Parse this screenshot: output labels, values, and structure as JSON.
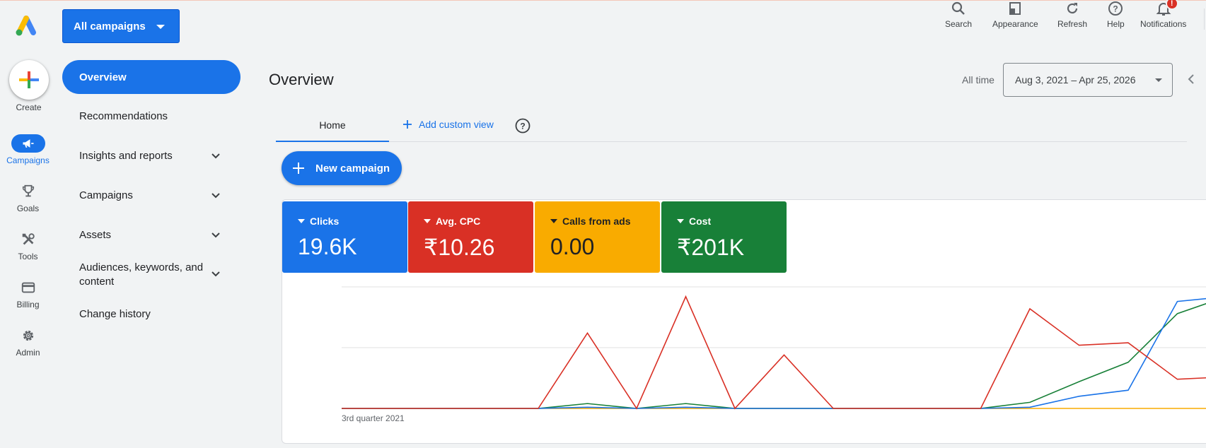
{
  "header": {
    "campaign_selector": "All campaigns",
    "actions": [
      {
        "label": "Search",
        "icon": "search-icon"
      },
      {
        "label": "Appearance",
        "icon": "appearance-icon"
      },
      {
        "label": "Refresh",
        "icon": "refresh-icon"
      },
      {
        "label": "Help",
        "icon": "help-icon"
      },
      {
        "label": "Notifications",
        "icon": "notifications-icon",
        "badge": "!"
      }
    ]
  },
  "rail": {
    "create_label": "Create",
    "items": [
      {
        "label": "Campaigns",
        "icon": "campaigns-icon",
        "active": true
      },
      {
        "label": "Goals",
        "icon": "trophy-icon"
      },
      {
        "label": "Tools",
        "icon": "tools-icon"
      },
      {
        "label": "Billing",
        "icon": "billing-icon"
      },
      {
        "label": "Admin",
        "icon": "gear-icon"
      }
    ]
  },
  "nav": {
    "items": [
      {
        "label": "Overview",
        "active": true
      },
      {
        "label": "Recommendations"
      },
      {
        "label": "Insights and reports",
        "expandable": true
      },
      {
        "label": "Campaigns",
        "expandable": true
      },
      {
        "label": "Assets",
        "expandable": true
      },
      {
        "label": "Audiences, keywords, and content",
        "expandable": true
      },
      {
        "label": "Change history"
      }
    ]
  },
  "main": {
    "title": "Overview",
    "date_preset": "All time",
    "date_range": "Aug 3, 2021 – Apr 25, 2026",
    "tabs": {
      "home": "Home",
      "add_custom": "Add custom view"
    },
    "new_campaign": "New campaign",
    "metrics": [
      {
        "name": "Clicks",
        "value": "19.6K",
        "color": "#1a73e8"
      },
      {
        "name": "Avg. CPC",
        "value": "₹10.26",
        "color": "#d93025"
      },
      {
        "name": "Calls from ads",
        "value": "0.00",
        "color": "#f9ab00"
      },
      {
        "name": "Cost",
        "value": "₹201K",
        "color": "#188038"
      }
    ]
  },
  "chart_data": {
    "type": "line",
    "x_start_label": "3rd quarter 2021",
    "grid": true,
    "series": [
      {
        "name": "Avg. CPC",
        "color": "#d93025",
        "values": [
          0,
          0,
          0,
          0,
          0,
          0.62,
          0,
          0.92,
          0,
          0.44,
          0,
          0,
          0,
          0,
          0.82,
          0.52,
          0.54,
          0.24,
          0.26,
          0.32
        ]
      },
      {
        "name": "Clicks",
        "color": "#1a73e8",
        "values": [
          0,
          0,
          0,
          0,
          0,
          0.01,
          0,
          0.01,
          0,
          0,
          0,
          0,
          0,
          0,
          0.01,
          0.1,
          0.15,
          0.88,
          0.92,
          0.8
        ]
      },
      {
        "name": "Cost",
        "color": "#188038",
        "values": [
          0,
          0,
          0,
          0,
          0,
          0.04,
          0,
          0.04,
          0,
          0,
          0,
          0,
          0,
          0,
          0.05,
          0.22,
          0.38,
          0.78,
          0.92,
          0.95
        ]
      },
      {
        "name": "Calls from ads",
        "color": "#f9ab00",
        "values": [
          0,
          0,
          0,
          0,
          0,
          0,
          0,
          0,
          0,
          0,
          0,
          0,
          0,
          0,
          0,
          0,
          0,
          0,
          0,
          0
        ]
      }
    ]
  }
}
